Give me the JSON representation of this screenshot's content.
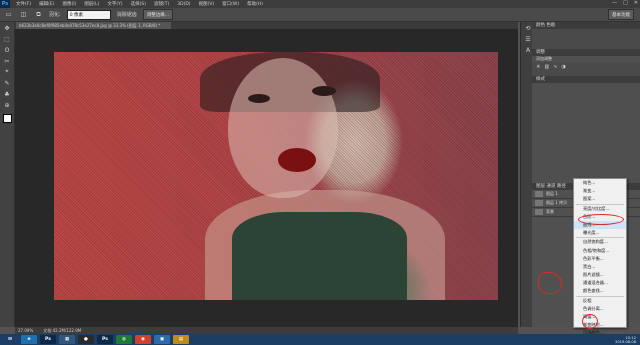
{
  "app": {
    "logo": "Ps",
    "window_buttons": [
      "—",
      "□",
      "✕"
    ]
  },
  "menubar": {
    "items": [
      "文件(F)",
      "编辑(E)",
      "图像(I)",
      "图层(L)",
      "文字(Y)",
      "选择(S)",
      "滤镜(T)",
      "3D(D)",
      "视图(V)",
      "窗口(W)",
      "帮助(H)"
    ]
  },
  "options": {
    "feather_label": "羽化:",
    "feather_value": "0 像素",
    "antialias_label": "消除锯齿",
    "refine_edge_label": "调整边缘...",
    "workspace_label": "基本功能"
  },
  "document": {
    "tab_title": "b623b3a0c8ef0f985eb4e078c53e27ec8.jpg @ 33.3% (图层 1, RGB/8) *",
    "zoom": "27.09%",
    "doc_info": "文档:42.2M/122.9M"
  },
  "tools": [
    "▭",
    "✥",
    "⬚",
    "ʘ",
    "✂",
    "⌖",
    "✎",
    "♣",
    "⊕",
    "▣",
    "◔",
    "◐",
    "✒",
    "T",
    "▸",
    "▭",
    "✋",
    "🔍"
  ],
  "panels": {
    "color_header": "颜色  色板",
    "adjust_header": "调整",
    "add_adjust_label": "添加调整",
    "styles_header": "样式",
    "layers_header": "图层  通道  路径",
    "layer_rows": [
      "图层 1",
      "图层 1 拷贝",
      "背景"
    ]
  },
  "context_menu": {
    "items": [
      "纯色...",
      "渐变...",
      "图案...",
      "亮度/对比度...",
      "色阶...",
      "曲线...",
      "曝光度...",
      "自然饱和度...",
      "色相/饱和度...",
      "色彩平衡...",
      "黑白...",
      "照片滤镜...",
      "通道混合器...",
      "颜色查找...",
      "反相",
      "色调分离...",
      "阈值...",
      "渐变映射...",
      "可选颜色..."
    ],
    "highlighted_index": 5
  },
  "annotations": {
    "color": "#d42b2b"
  },
  "taskbar": {
    "apps": [
      {
        "label": "⊞",
        "color": "#1c3d64"
      },
      {
        "label": "e",
        "color": "#1f6fb3"
      },
      {
        "label": "Ps",
        "color": "#0b2a4a"
      },
      {
        "label": "▦",
        "color": "#33577a"
      },
      {
        "label": "●",
        "color": "#2a2a2a"
      },
      {
        "label": "Ps",
        "color": "#0b2a4a"
      },
      {
        "label": "◍",
        "color": "#1f7a3a"
      },
      {
        "label": "◉",
        "color": "#d0402a"
      },
      {
        "label": "▣",
        "color": "#2d6aa8"
      },
      {
        "label": "▤",
        "color": "#c08a1a"
      }
    ],
    "clock_time": "10:12",
    "clock_date": "2019-08-08"
  }
}
